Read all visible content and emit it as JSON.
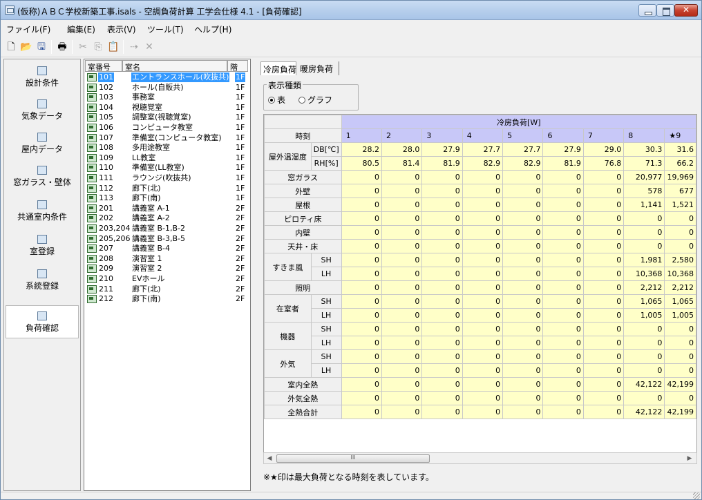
{
  "window": {
    "title": "(仮称)ＡＢＣ学校新築工事.isals - 空調負荷計算 工学会仕様 4.1 - [負荷確認]"
  },
  "menu": [
    "ファイル(F)",
    "編集(E)",
    "表示(V)",
    "ツール(T)",
    "ヘルプ(H)"
  ],
  "toolbar_icons": [
    "new-file-icon",
    "open-folder-icon",
    "save-icon",
    "print-icon",
    "cut-icon",
    "copy-icon",
    "paste-icon",
    "link-icon",
    "delete-icon"
  ],
  "nav": [
    {
      "label": "設計条件",
      "icon": "settings-doc-icon"
    },
    {
      "label": "気象データ",
      "icon": "weather-icon"
    },
    {
      "label": "屋内データ",
      "icon": "indoor-icon"
    },
    {
      "label": "窓ガラス・壁体",
      "icon": "window-wall-icon"
    },
    {
      "label": "共通室内条件",
      "icon": "common-room-icon"
    },
    {
      "label": "室登録",
      "icon": "room-register-icon"
    },
    {
      "label": "系統登録",
      "icon": "system-register-icon"
    },
    {
      "label": "負荷確認",
      "icon": "load-check-icon"
    }
  ],
  "room_list": {
    "headers": {
      "num": "室番号",
      "name": "室名",
      "floor": "階"
    },
    "rows": [
      {
        "num": "101",
        "name": "エントランスホール(吹抜共)",
        "floor": "1F"
      },
      {
        "num": "102",
        "name": "ホール(自販共)",
        "floor": "1F"
      },
      {
        "num": "103",
        "name": "事務室",
        "floor": "1F"
      },
      {
        "num": "104",
        "name": "視聴覚室",
        "floor": "1F"
      },
      {
        "num": "105",
        "name": "調整室(視聴覚室)",
        "floor": "1F"
      },
      {
        "num": "106",
        "name": "コンピュータ教室",
        "floor": "1F"
      },
      {
        "num": "107",
        "name": "準備室(コンピュータ教室)",
        "floor": "1F"
      },
      {
        "num": "108",
        "name": "多用途教室",
        "floor": "1F"
      },
      {
        "num": "109",
        "name": "LL教室",
        "floor": "1F"
      },
      {
        "num": "110",
        "name": "準備室(LL教室)",
        "floor": "1F"
      },
      {
        "num": "111",
        "name": "ラウンジ(吹抜共)",
        "floor": "1F"
      },
      {
        "num": "112",
        "name": "廊下(北)",
        "floor": "1F"
      },
      {
        "num": "113",
        "name": "廊下(南)",
        "floor": "1F"
      },
      {
        "num": "201",
        "name": "講義室 A-1",
        "floor": "2F"
      },
      {
        "num": "202",
        "name": "講義室 A-2",
        "floor": "2F"
      },
      {
        "num": "203,204",
        "name": "講義室 B-1,B-2",
        "floor": "2F"
      },
      {
        "num": "205,206",
        "name": "講義室 B-3,B-5",
        "floor": "2F"
      },
      {
        "num": "207",
        "name": "講義室 B-4",
        "floor": "2F"
      },
      {
        "num": "208",
        "name": "演習室 1",
        "floor": "2F"
      },
      {
        "num": "209",
        "name": "演習室 2",
        "floor": "2F"
      },
      {
        "num": "210",
        "name": "EVホール",
        "floor": "2F"
      },
      {
        "num": "211",
        "name": "廊下(北)",
        "floor": "2F"
      },
      {
        "num": "212",
        "name": "廊下(南)",
        "floor": "2F"
      }
    ]
  },
  "tabs": [
    "冷房負荷",
    "暖房負荷"
  ],
  "display_type": {
    "legend": "表示種類",
    "options": [
      "表",
      "グラフ"
    ],
    "selected": "表"
  },
  "load_table": {
    "header": "冷房負荷[W]",
    "time_label": "時刻",
    "hours": [
      "1",
      "2",
      "3",
      "4",
      "5",
      "6",
      "7",
      "8",
      "★9"
    ],
    "rows": [
      {
        "group": "屋外温湿度",
        "sub": "DB[℃]",
        "values": [
          "28.2",
          "28.0",
          "27.9",
          "27.7",
          "27.7",
          "27.9",
          "29.0",
          "30.3",
          "31.6"
        ]
      },
      {
        "group": "",
        "sub": "RH[%]",
        "values": [
          "80.5",
          "81.4",
          "81.9",
          "82.9",
          "82.9",
          "81.9",
          "76.8",
          "71.3",
          "66.2"
        ]
      },
      {
        "group": "窓ガラス",
        "sub": "",
        "values": [
          "0",
          "0",
          "0",
          "0",
          "0",
          "0",
          "0",
          "20,977",
          "19,969"
        ]
      },
      {
        "group": "外壁",
        "sub": "",
        "values": [
          "0",
          "0",
          "0",
          "0",
          "0",
          "0",
          "0",
          "578",
          "677"
        ]
      },
      {
        "group": "屋根",
        "sub": "",
        "values": [
          "0",
          "0",
          "0",
          "0",
          "0",
          "0",
          "0",
          "1,141",
          "1,521"
        ]
      },
      {
        "group": "ピロティ床",
        "sub": "",
        "values": [
          "0",
          "0",
          "0",
          "0",
          "0",
          "0",
          "0",
          "0",
          "0"
        ]
      },
      {
        "group": "内壁",
        "sub": "",
        "values": [
          "0",
          "0",
          "0",
          "0",
          "0",
          "0",
          "0",
          "0",
          "0"
        ]
      },
      {
        "group": "天井・床",
        "sub": "",
        "values": [
          "0",
          "0",
          "0",
          "0",
          "0",
          "0",
          "0",
          "0",
          "0"
        ]
      },
      {
        "group": "すきま風",
        "sub": "SH",
        "values": [
          "0",
          "0",
          "0",
          "0",
          "0",
          "0",
          "0",
          "1,981",
          "2,580"
        ]
      },
      {
        "group": "",
        "sub": "LH",
        "values": [
          "0",
          "0",
          "0",
          "0",
          "0",
          "0",
          "0",
          "10,368",
          "10,368"
        ]
      },
      {
        "group": "照明",
        "sub": "",
        "values": [
          "0",
          "0",
          "0",
          "0",
          "0",
          "0",
          "0",
          "2,212",
          "2,212"
        ]
      },
      {
        "group": "在室者",
        "sub": "SH",
        "values": [
          "0",
          "0",
          "0",
          "0",
          "0",
          "0",
          "0",
          "1,065",
          "1,065"
        ]
      },
      {
        "group": "",
        "sub": "LH",
        "values": [
          "0",
          "0",
          "0",
          "0",
          "0",
          "0",
          "0",
          "1,005",
          "1,005"
        ]
      },
      {
        "group": "機器",
        "sub": "SH",
        "values": [
          "0",
          "0",
          "0",
          "0",
          "0",
          "0",
          "0",
          "0",
          "0"
        ]
      },
      {
        "group": "",
        "sub": "LH",
        "values": [
          "0",
          "0",
          "0",
          "0",
          "0",
          "0",
          "0",
          "0",
          "0"
        ]
      },
      {
        "group": "外気",
        "sub": "SH",
        "values": [
          "0",
          "0",
          "0",
          "0",
          "0",
          "0",
          "0",
          "0",
          "0"
        ]
      },
      {
        "group": "",
        "sub": "LH",
        "values": [
          "0",
          "0",
          "0",
          "0",
          "0",
          "0",
          "0",
          "0",
          "0"
        ]
      },
      {
        "group": "室内全熱",
        "sub": "",
        "values": [
          "0",
          "0",
          "0",
          "0",
          "0",
          "0",
          "0",
          "42,122",
          "42,199"
        ]
      },
      {
        "group": "外気全熱",
        "sub": "",
        "values": [
          "0",
          "0",
          "0",
          "0",
          "0",
          "0",
          "0",
          "0",
          "0"
        ]
      },
      {
        "group": "全熱合計",
        "sub": "",
        "values": [
          "0",
          "0",
          "0",
          "0",
          "0",
          "0",
          "0",
          "42,122",
          "42,199"
        ]
      }
    ]
  },
  "scrollbar_grip": "III",
  "footnote": "※★印は最大負荷となる時刻を表しています。",
  "colors": {
    "selection": "#3399ff",
    "value_cell": "#ffffc8",
    "header_cell": "#c8c8f8",
    "label_cell": "#f0f0f0"
  }
}
